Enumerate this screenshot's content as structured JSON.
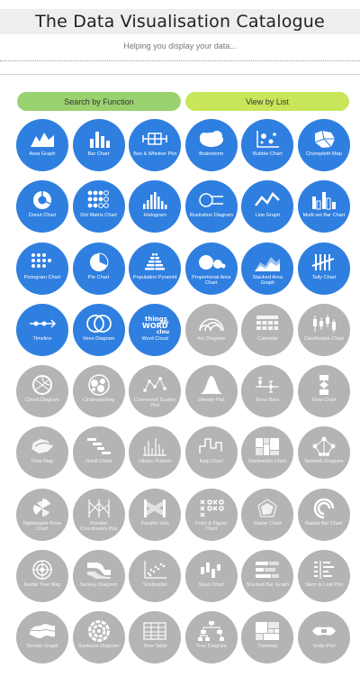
{
  "header": {
    "title": "The Data Visualisation Catalogue",
    "tagline": "Helping you display your data..."
  },
  "nav": {
    "search_by_function": "Search by Function",
    "view_by_list": "View by List"
  },
  "colors": {
    "active": "#2f7fe0",
    "inactive": "#b4b4b4",
    "function_button": "#9ad26f",
    "list_button": "#c8e65a"
  },
  "charts": [
    {
      "label": "Area Graph",
      "icon": "area-graph-icon",
      "active": true
    },
    {
      "label": "Bar Chart",
      "icon": "bar-chart-icon",
      "active": true
    },
    {
      "label": "Box & Whisker Plot",
      "icon": "box-whisker-plot-icon",
      "active": true
    },
    {
      "label": "Brainstorm",
      "icon": "brainstorm-icon",
      "active": true
    },
    {
      "label": "Bubble Chart",
      "icon": "bubble-chart-icon",
      "active": true
    },
    {
      "label": "Choropleth Map",
      "icon": "choropleth-map-icon",
      "active": true
    },
    {
      "label": "Donut Chart",
      "icon": "donut-chart-icon",
      "active": true
    },
    {
      "label": "Dot Matrix Chart",
      "icon": "dot-matrix-chart-icon",
      "active": true
    },
    {
      "label": "Histogram",
      "icon": "histogram-icon",
      "active": true
    },
    {
      "label": "Illustration Diagram",
      "icon": "illustration-diagram-icon",
      "active": true
    },
    {
      "label": "Line Graph",
      "icon": "line-graph-icon",
      "active": true
    },
    {
      "label": "Multi-set Bar Chart",
      "icon": "multi-set-bar-chart-icon",
      "active": true
    },
    {
      "label": "Pictogram Chart",
      "icon": "pictogram-chart-icon",
      "active": true
    },
    {
      "label": "Pie Chart",
      "icon": "pie-chart-icon",
      "active": true
    },
    {
      "label": "Population Pyramid",
      "icon": "population-pyramid-icon",
      "active": true
    },
    {
      "label": "Proportional Area Chart",
      "icon": "proportional-area-chart-icon",
      "active": true
    },
    {
      "label": "Stacked Area Graph",
      "icon": "stacked-area-graph-icon",
      "active": true
    },
    {
      "label": "Tally Chart",
      "icon": "tally-chart-icon",
      "active": true
    },
    {
      "label": "Timeline",
      "icon": "timeline-icon",
      "active": true
    },
    {
      "label": "Venn Diagram",
      "icon": "venn-diagram-icon",
      "active": true
    },
    {
      "label": "Word Cloud",
      "icon": "word-cloud-icon",
      "active": true
    },
    {
      "label": "Arc Diagram",
      "icon": "arc-diagram-icon",
      "active": false
    },
    {
      "label": "Calendar",
      "icon": "calendar-icon",
      "active": false
    },
    {
      "label": "Candlestick Chart",
      "icon": "candlestick-chart-icon",
      "active": false
    },
    {
      "label": "Chord Diagram",
      "icon": "chord-diagram-icon",
      "active": false
    },
    {
      "label": "Circle-packing",
      "icon": "circle-packing-icon",
      "active": false
    },
    {
      "label": "Connected Scatter Plot",
      "icon": "connected-scatter-plot-icon",
      "active": false
    },
    {
      "label": "Density Plot",
      "icon": "density-plot-icon",
      "active": false
    },
    {
      "label": "Error Bars",
      "icon": "error-bars-icon",
      "active": false
    },
    {
      "label": "Flow Chart",
      "icon": "flow-chart-icon",
      "active": false
    },
    {
      "label": "Flow Map",
      "icon": "flow-map-icon",
      "active": false
    },
    {
      "label": "Gantt Chart",
      "icon": "gantt-chart-icon",
      "active": false
    },
    {
      "label": "Hikaku Pattern",
      "icon": "hikaku-pattern-icon",
      "active": false
    },
    {
      "label": "Kagi Chart",
      "icon": "kagi-chart-icon",
      "active": false
    },
    {
      "label": "Marimekko Chart",
      "icon": "marimekko-chart-icon",
      "active": false
    },
    {
      "label": "Network Diagram",
      "icon": "network-diagram-icon",
      "active": false
    },
    {
      "label": "Nightingale Rose Chart",
      "icon": "nightingale-rose-chart-icon",
      "active": false
    },
    {
      "label": "Parallel Coordinates Plot",
      "icon": "parallel-coordinates-plot-icon",
      "active": false
    },
    {
      "label": "Parallel Sets",
      "icon": "parallel-sets-icon",
      "active": false
    },
    {
      "label": "Point & Figure Chart",
      "icon": "point-figure-chart-icon",
      "active": false
    },
    {
      "label": "Radar Chart",
      "icon": "radar-chart-icon",
      "active": false
    },
    {
      "label": "Radial Bar Chart",
      "icon": "radial-bar-chart-icon",
      "active": false
    },
    {
      "label": "Radial Tree Map",
      "icon": "radial-tree-map-icon",
      "active": false
    },
    {
      "label": "Sankey Diagram",
      "icon": "sankey-diagram-icon",
      "active": false
    },
    {
      "label": "Scatterplot",
      "icon": "scatterplot-icon",
      "active": false
    },
    {
      "label": "Span Chart",
      "icon": "span-chart-icon",
      "active": false
    },
    {
      "label": "Stacked Bar Graph",
      "icon": "stacked-bar-graph-icon",
      "active": false
    },
    {
      "label": "Stem & Leaf Plot",
      "icon": "stem-leaf-plot-icon",
      "active": false
    },
    {
      "label": "Stream Graph",
      "icon": "stream-graph-icon",
      "active": false
    },
    {
      "label": "Sunburst Diagram",
      "icon": "sunburst-diagram-icon",
      "active": false
    },
    {
      "label": "Time Table",
      "icon": "time-table-icon",
      "active": false
    },
    {
      "label": "Tree Diagram",
      "icon": "tree-diagram-icon",
      "active": false
    },
    {
      "label": "Treemap",
      "icon": "treemap-icon",
      "active": false
    },
    {
      "label": "Violin Plot",
      "icon": "violin-plot-icon",
      "active": false
    }
  ]
}
